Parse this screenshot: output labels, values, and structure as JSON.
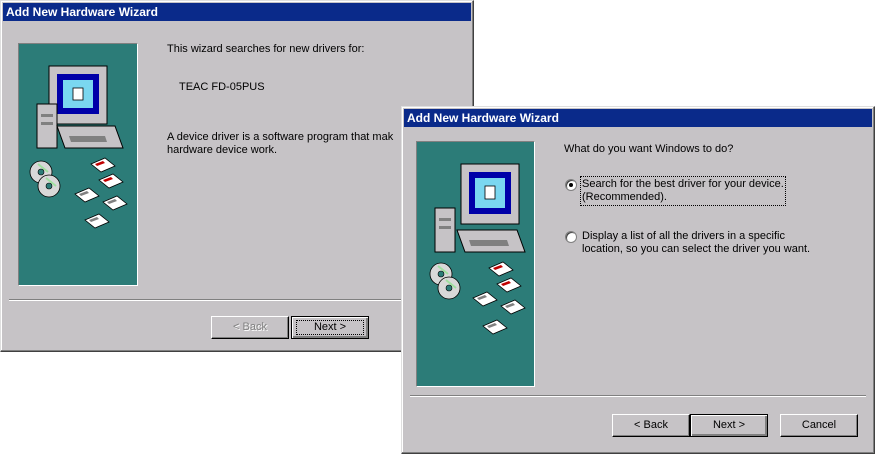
{
  "wizard_back": {
    "title": "Add New Hardware Wizard",
    "intro": "This wizard searches for new drivers for:",
    "device": "TEAC FD-05PUS",
    "desc_line1": "A device driver is a software program that mak",
    "desc_line2": "hardware device work.",
    "back_label": "< Back",
    "next_label": "Next >"
  },
  "wizard_front": {
    "title": "Add New Hardware Wizard",
    "question": "What do you want Windows to do?",
    "option1_line1": "Search for the best driver for your device.",
    "option1_line2": "(Recommended).",
    "option2_line1": "Display a list of all the drivers in a specific",
    "option2_line2": "location, so you can select the driver you want.",
    "option1_selected": true,
    "back_label": "< Back",
    "next_label": "Next >",
    "cancel_label": "Cancel"
  },
  "icons": [
    "computer-icon",
    "cd-disc-icon",
    "floppy-disk-icon"
  ],
  "colors": {
    "titlebar": "#0a2a8a",
    "panel": "#2c7c78",
    "window": "#c6c3c6"
  }
}
